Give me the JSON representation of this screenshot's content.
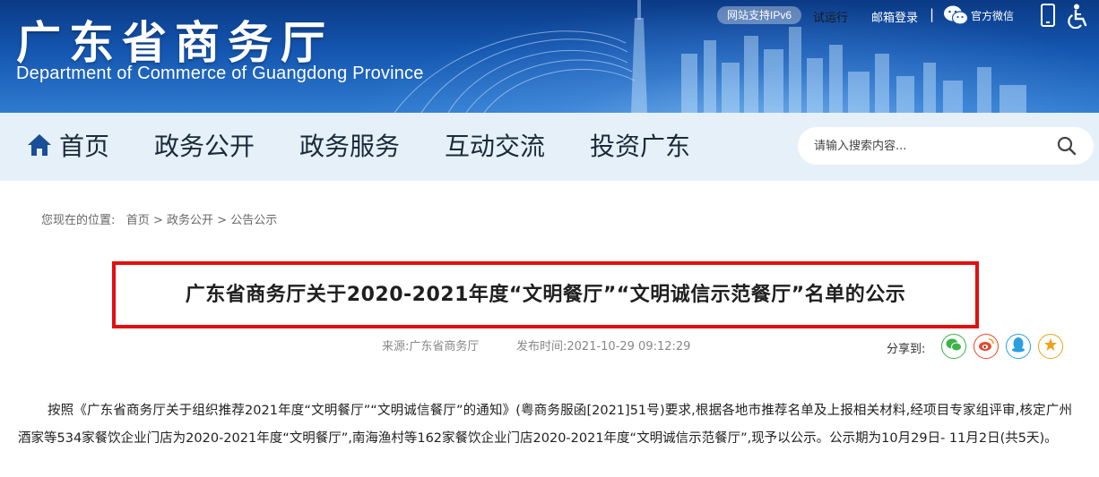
{
  "header": {
    "site_title": "广东省商务厅",
    "site_subtitle": "Department of Commerce of Guangdong Province",
    "ipv6_badge": "网站支持IPv6",
    "trial_label": "试运行",
    "mail_login": "邮箱登录",
    "separator": "|",
    "wechat_label": "官方微信"
  },
  "nav": {
    "items": [
      {
        "label": "首页"
      },
      {
        "label": "政务公开"
      },
      {
        "label": "政务服务"
      },
      {
        "label": "互动交流"
      },
      {
        "label": "投资广东"
      }
    ],
    "search_placeholder": "请输入搜索内容..."
  },
  "breadcrumb": {
    "prefix": "您现在的位置:",
    "items": [
      "首页",
      "政务公开",
      "公告公示"
    ],
    "separator": ">"
  },
  "article": {
    "title": "广东省商务厅关于2020-2021年度“文明餐厅”“文明诚信示范餐厅”名单的公示",
    "source": "来源:广东省商务厅",
    "publish_time": "发布时间:2021-10-29 09:12:29",
    "share_label": "分享到:",
    "body": "按照《广东省商务厅关于组织推荐2021年度“文明餐厅”“文明诚信餐厅”的通知》(粤商务服函[2021]51号)要求,根据各地市推荐名单及上报相关材料,经项目专家组评审,核定广州酒家等534家餐饮企业门店为2020-2021年度“文明餐厅”,南海渔村等162家餐饮企业门店2020-2021年度“文明诚信示范餐厅”,现予以公示。公示期为10月29日- 11月2日(共5天)。"
  },
  "colors": {
    "banner": "#1456b0",
    "nav_bg": "#e6f0f8",
    "title_border": "#e30f0f",
    "share_wechat": "#3bb44a",
    "share_weibo": "#e6492d",
    "share_qq": "#2a9fe0",
    "share_favorite": "#f0a21b"
  },
  "icons": {
    "home": "home-icon",
    "search": "search-icon",
    "wechat": "wechat-icon",
    "phone": "mobile-phone-icon",
    "accessibility": "wheelchair-icon",
    "weibo": "weibo-icon",
    "qq": "qq-icon",
    "favorite": "star-icon"
  }
}
